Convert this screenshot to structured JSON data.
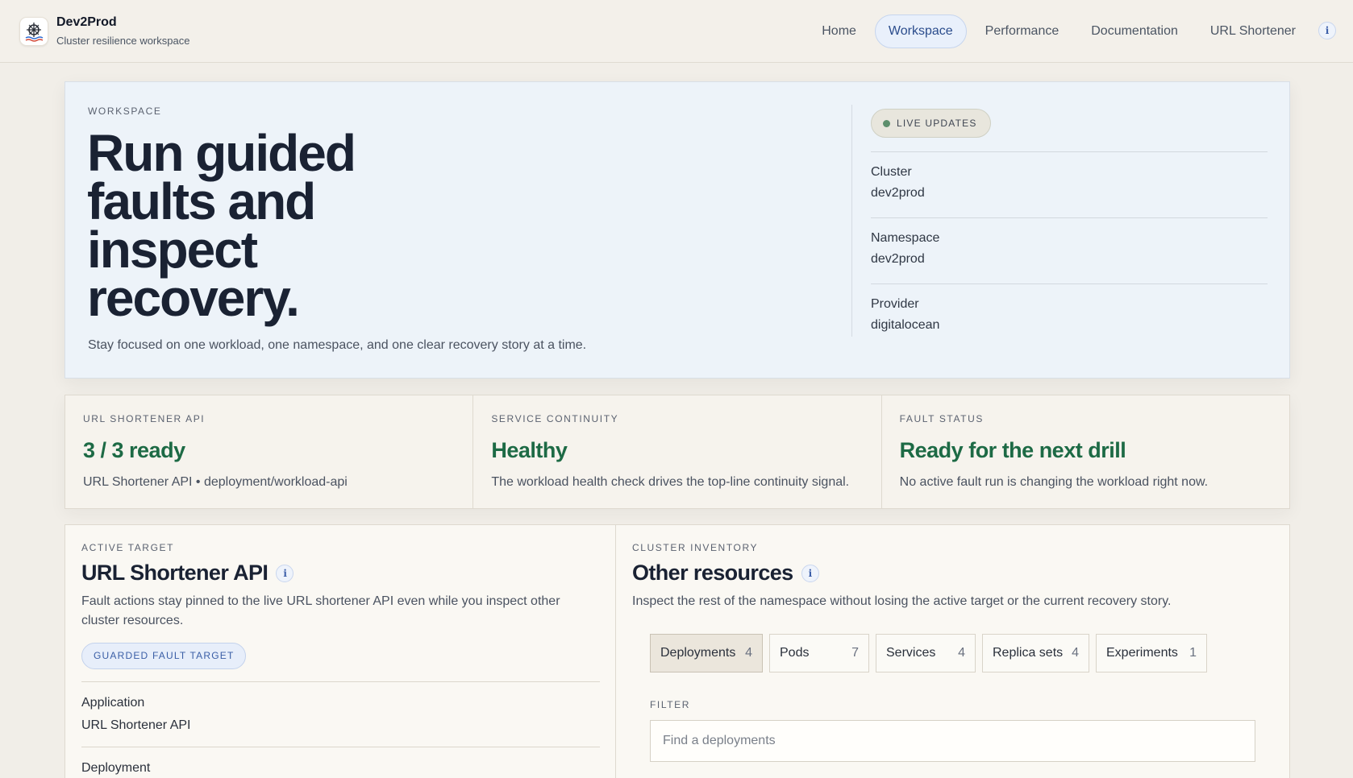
{
  "brand": {
    "name": "Dev2Prod",
    "subtitle": "Cluster resilience workspace",
    "logo_icon": "ship-wheel-icon"
  },
  "nav": {
    "items": [
      {
        "label": "Home",
        "active": false
      },
      {
        "label": "Workspace",
        "active": true
      },
      {
        "label": "Performance",
        "active": false
      },
      {
        "label": "Documentation",
        "active": false
      },
      {
        "label": "URL Shortener",
        "active": false
      }
    ],
    "info_glyph": "i"
  },
  "hero": {
    "eyebrow": "WORKSPACE",
    "title": "Run guided faults and inspect recovery.",
    "description": "Stay focused on one workload, one namespace, and one clear recovery story at a time.",
    "live_badge": "LIVE UPDATES",
    "meta": [
      {
        "label": "Cluster",
        "value": "dev2prod"
      },
      {
        "label": "Namespace",
        "value": "dev2prod"
      },
      {
        "label": "Provider",
        "value": "digitalocean"
      }
    ]
  },
  "status": [
    {
      "eyebrow": "URL SHORTENER API",
      "headline": "3 / 3 ready",
      "description": "URL Shortener API • deployment/workload-api"
    },
    {
      "eyebrow": "SERVICE CONTINUITY",
      "headline": "Healthy",
      "description": "The workload health check drives the top-line continuity signal."
    },
    {
      "eyebrow": "FAULT STATUS",
      "headline": "Ready for the next drill",
      "description": "No active fault run is changing the workload right now."
    }
  ],
  "active_target": {
    "eyebrow": "ACTIVE TARGET",
    "title": "URL Shortener API",
    "description": "Fault actions stay pinned to the live URL shortener API even while you inspect other cluster resources.",
    "badge": "GUARDED FAULT TARGET",
    "details": [
      {
        "label": "Application",
        "value": "URL Shortener API"
      },
      {
        "label": "Deployment",
        "value": ""
      }
    ]
  },
  "inventory": {
    "eyebrow": "CLUSTER INVENTORY",
    "title": "Other resources",
    "description": "Inspect the rest of the namespace without losing the active target or the current recovery story.",
    "tabs": [
      {
        "label": "Deployments",
        "count": "4",
        "active": true
      },
      {
        "label": "Pods",
        "count": "7",
        "active": false
      },
      {
        "label": "Services",
        "count": "4",
        "active": false
      },
      {
        "label": "Replica sets",
        "count": "4",
        "active": false
      },
      {
        "label": "Experiments",
        "count": "1",
        "active": false
      }
    ],
    "filter_label": "FILTER",
    "filter_placeholder": "Find a deployments",
    "filter_value": ""
  },
  "colors": {
    "accent_green": "#1d6a45",
    "accent_blue": "#2b4c8c",
    "live_dot": "#5d8f6d"
  }
}
